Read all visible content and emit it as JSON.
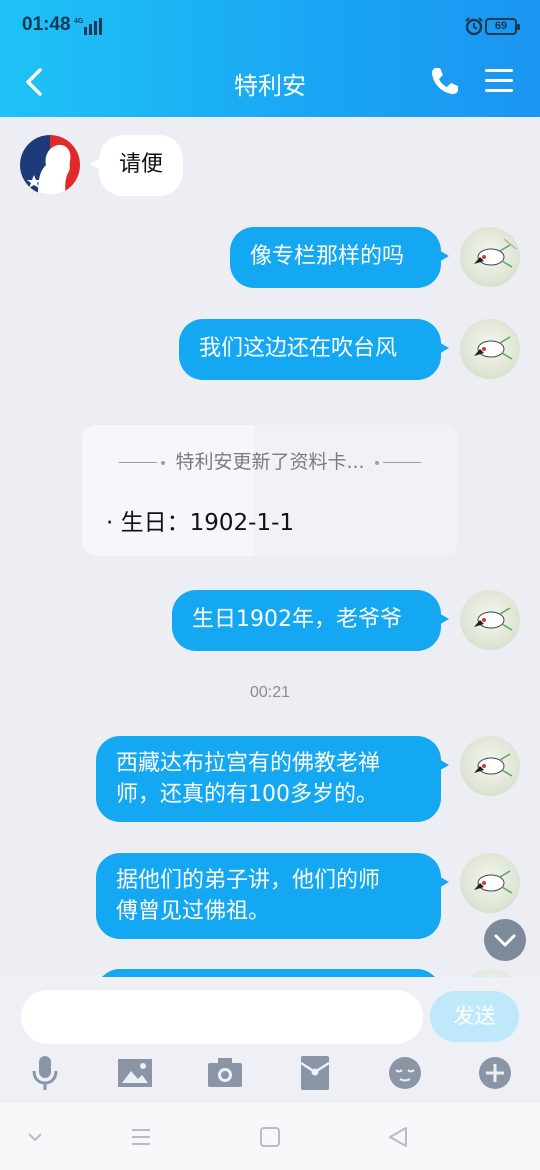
{
  "status": {
    "time": "01:48",
    "network": "4G",
    "battery": "69"
  },
  "header": {
    "title": "特利安"
  },
  "messages": [
    {
      "side": "in",
      "text": "请便"
    },
    {
      "side": "out",
      "text": "像专栏那样的吗"
    },
    {
      "side": "out",
      "text": "我们这边还在吹台风"
    },
    {
      "side": "card",
      "title": "特利安更新了资料卡...",
      "body": "· 生日：1902-1-1"
    },
    {
      "side": "out",
      "text": "生日1902年，老爷爷"
    },
    {
      "side": "time",
      "text": "00:21"
    },
    {
      "side": "out",
      "line1": "西藏达布拉宫有的佛教老禅",
      "line2": "师，还真的有100多岁的。"
    },
    {
      "side": "out",
      "line1": "据他们的弟子讲，他们的师",
      "line2": "傅曾见过佛祖。"
    }
  ],
  "input": {
    "placeholder": "",
    "send_label": "发送"
  },
  "colors": {
    "header_start": "#1ec3f6",
    "header_end": "#1b95f2",
    "bubble_out": "#14a8f2",
    "send_disabled": "#bfe9fb"
  },
  "icons": [
    "voice-icon",
    "image-icon",
    "camera-icon",
    "red-packet-icon",
    "emoji-icon",
    "plus-icon"
  ]
}
